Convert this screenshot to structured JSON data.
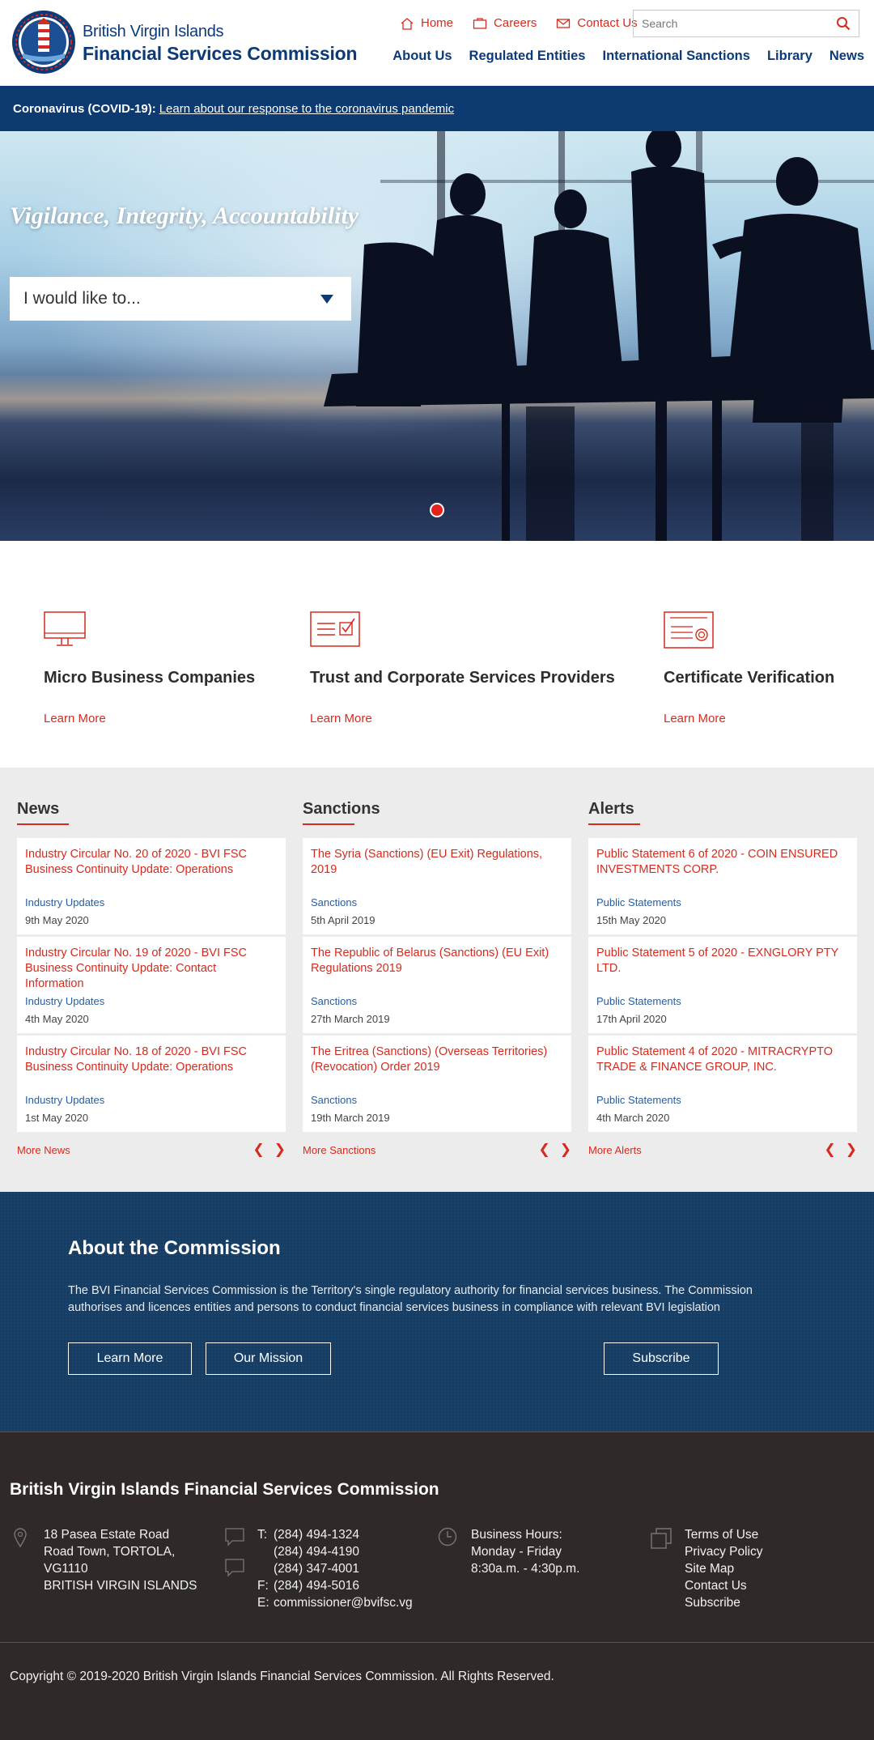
{
  "brand": {
    "line1": "British Virgin Islands",
    "line2": "Financial Services Commission",
    "logo_text": "FSC"
  },
  "utility_nav": [
    {
      "label": "Home",
      "icon": "home-icon"
    },
    {
      "label": "Careers",
      "icon": "briefcase-icon"
    },
    {
      "label": "Contact Us",
      "icon": "envelope-icon"
    }
  ],
  "search": {
    "placeholder": "Search"
  },
  "main_nav": [
    "About Us",
    "Regulated Entities",
    "International Sanctions",
    "Library",
    "News"
  ],
  "covid": {
    "label": "Coronavirus (COVID-19):",
    "link": "Learn about our response to the coronavirus pandemic"
  },
  "hero": {
    "tagline": "Vigilance, Integrity, Accountability",
    "dropdown": "I would like to..."
  },
  "features": [
    {
      "title": "Micro Business Companies",
      "link": "Learn More",
      "icon": "monitor-icon"
    },
    {
      "title": "Trust and Corporate Services Providers",
      "link": "Learn More",
      "icon": "checklist-icon"
    },
    {
      "title": "Certificate Verification",
      "link": "Learn More",
      "icon": "certificate-icon"
    }
  ],
  "columns": [
    {
      "heading": "News",
      "more": "More News",
      "items": [
        {
          "title": "Industry Circular No. 20 of 2020 - BVI FSC Business Continuity Update: Operations",
          "category": "Industry Updates",
          "date": "9th May 2020"
        },
        {
          "title": "Industry Circular No. 19 of 2020 - BVI FSC Business Continuity Update: Contact Information",
          "category": "Industry Updates",
          "date": "4th May 2020"
        },
        {
          "title": "Industry Circular No. 18 of 2020 - BVI FSC Business Continuity Update: Operations",
          "category": "Industry Updates",
          "date": "1st May 2020"
        }
      ]
    },
    {
      "heading": "Sanctions",
      "more": "More Sanctions",
      "items": [
        {
          "title": "The Syria (Sanctions) (EU Exit) Regulations, 2019",
          "category": "Sanctions",
          "date": "5th April 2019"
        },
        {
          "title": "The Republic of Belarus (Sanctions) (EU Exit) Regulations 2019",
          "category": "Sanctions",
          "date": "27th March 2019"
        },
        {
          "title": "The Eritrea (Sanctions) (Overseas Territories) (Revocation) Order 2019",
          "category": "Sanctions",
          "date": "19th March 2019"
        }
      ]
    },
    {
      "heading": "Alerts",
      "more": "More Alerts",
      "items": [
        {
          "title": "Public Statement 6 of 2020 - COIN ENSURED INVESTMENTS CORP.",
          "category": "Public Statements",
          "date": "15th May 2020"
        },
        {
          "title": "Public Statement 5 of 2020 - EXNGLORY PTY LTD.",
          "category": "Public Statements",
          "date": "17th April 2020"
        },
        {
          "title": "Public Statement 4 of 2020 - MITRACRYPTO TRADE & FINANCE GROUP, INC.",
          "category": "Public Statements",
          "date": "4th March 2020"
        }
      ]
    }
  ],
  "about": {
    "heading": "About the Commission",
    "text": "The BVI Financial Services Commission is the Territory's single regulatory authority for financial services business.  The Commission authorises and licences entities and persons to conduct financial services business in compliance with relevant BVI legislation",
    "buttons": [
      "Learn More",
      "Our Mission",
      "Subscribe"
    ]
  },
  "footer": {
    "heading": "British Virgin Islands Financial Services Commission",
    "address": [
      "18 Pasea Estate Road",
      "Road Town, TORTOLA,",
      "VG1110",
      "BRITISH VIRGIN ISLANDS"
    ],
    "phones": [
      {
        "k": "T:",
        "v": "(284) 494-1324"
      },
      {
        "k": "",
        "v": "(284) 494-4190"
      },
      {
        "k": "",
        "v": "(284) 347-4001"
      },
      {
        "k": "F:",
        "v": "(284) 494-5016"
      },
      {
        "k": "E:",
        "v": "commissioner@bvifsc.vg"
      }
    ],
    "hours": [
      "Business Hours:",
      "Monday - Friday",
      "8:30a.m. - 4:30p.m."
    ],
    "links": [
      "Terms of Use",
      "Privacy Policy",
      "Site Map",
      "Contact Us",
      "Subscribe"
    ],
    "copyright": "Copyright © 2019-2020 British Virgin Islands Financial Services Commission. All Rights Reserved."
  },
  "colors": {
    "brand_blue": "#0c3a78",
    "accent_red": "#d52b1e",
    "about_bg": "#163d64",
    "footer_bg": "#2f2a28"
  }
}
